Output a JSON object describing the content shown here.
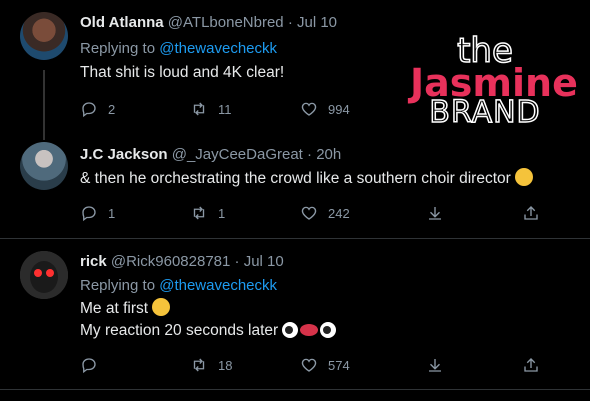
{
  "watermark": {
    "line1": "the",
    "line2": "Jasmine",
    "line3": "BRAND",
    "accent_color": "#e8315b"
  },
  "tweets": [
    {
      "name": "Old Atlanna",
      "handle": "@ATLboneNbred",
      "date": "Jul 10",
      "replying_prefix": "Replying to",
      "replying_to": "@thewavecheckk",
      "text": "That shit is loud and 4K clear!",
      "replies": "2",
      "retweets": "11",
      "likes": "994"
    },
    {
      "name": "J.C Jackson",
      "handle": "@_JayCeeDaGreat",
      "date": "20h",
      "text": "& then he orchestrating the crowd like a southern choir director",
      "replies": "1",
      "retweets": "1",
      "likes": "242"
    },
    {
      "name": "rick",
      "handle": "@Rick960828781",
      "date": "Jul 10",
      "replying_prefix": "Replying to",
      "replying_to": "@thewavecheckk",
      "text_line1": "Me at first",
      "text_line2": "My reaction 20 seconds later",
      "retweets": "18",
      "likes": "574"
    }
  ],
  "icons": [
    "reply-icon",
    "retweet-icon",
    "like-icon",
    "download-icon",
    "share-icon"
  ],
  "colors": {
    "link": "#1d9bf0",
    "muted": "#8b98a5",
    "background": "#000000"
  }
}
